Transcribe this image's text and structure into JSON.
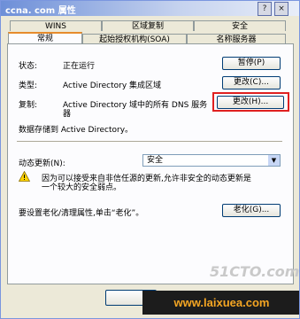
{
  "window": {
    "title": "ccna. com 属性",
    "help_glyph": "?",
    "close_glyph": "×"
  },
  "tabs_row1": [
    "WINS",
    "区域复制",
    "安全"
  ],
  "tabs_row2": [
    "常规",
    "起始授权机构(SOA)",
    "名称服务器"
  ],
  "status": {
    "label": "状态:",
    "value": "正在运行",
    "button": "暂停(P)"
  },
  "type": {
    "label": "类型:",
    "value": "Active Directory 集成区域",
    "button": "更改(C)..."
  },
  "replication": {
    "label": "复制:",
    "value_line1": "Active Directory 域中的所有 DNS 服务",
    "value_line2": "器",
    "button": "更改(H)..."
  },
  "storage_text": "数据存储到 Active Directory。",
  "dynamic_update": {
    "label": "动态更新(N):",
    "selected": "安全",
    "warning_line1": "因为可以接受来自非信任源的更新,允许非安全的动态更新是",
    "warning_line2": "一个较大的安全弱点。"
  },
  "aging": {
    "text": "要设置老化/清理属性,单击“老化”。",
    "button": "老化(G)..."
  },
  "watermark": {
    "logo": "51CTO.com",
    "site": "www.laixuea.com"
  }
}
